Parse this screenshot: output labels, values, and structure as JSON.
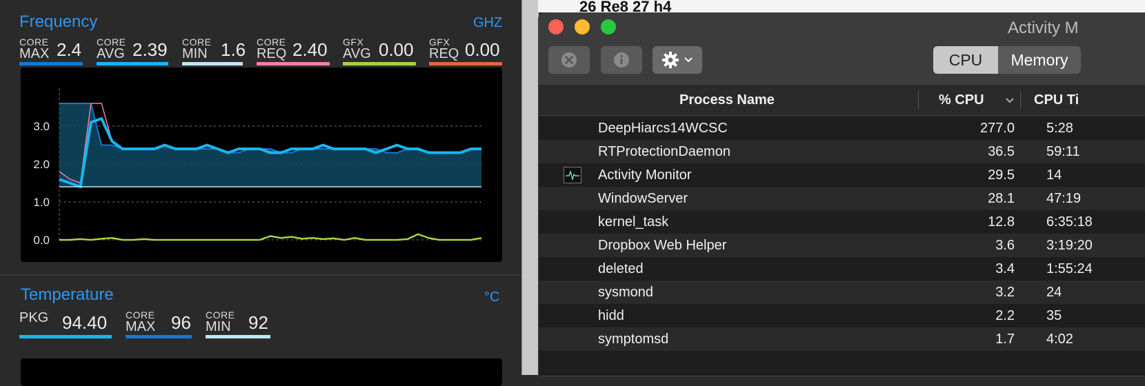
{
  "gadget": {
    "frequency": {
      "title": "Frequency",
      "unit": "GHZ",
      "metrics": [
        {
          "l1": "CORE",
          "l2": "MAX",
          "value": "2.4",
          "color": "#1577d6"
        },
        {
          "l1": "CORE",
          "l2": "AVG",
          "value": "2.39",
          "color": "#19b5f0"
        },
        {
          "l1": "CORE",
          "l2": "MIN",
          "value": "1.6",
          "color": "#bfe7f7"
        },
        {
          "l1": "CORE",
          "l2": "REQ",
          "value": "2.40",
          "color": "#f07fa8"
        },
        {
          "l1": "GFX",
          "l2": "AVG",
          "value": "0.00",
          "color": "#a6d443"
        },
        {
          "l1": "GFX",
          "l2": "REQ",
          "value": "0.00",
          "color": "#e0653e"
        }
      ],
      "y_ticks": [
        "3.0",
        "2.0",
        "1.0",
        "0.0"
      ]
    },
    "temperature": {
      "title": "Temperature",
      "unit": "°C",
      "metrics": [
        {
          "l1": "",
          "l2": "PKG",
          "value": "94.40",
          "color": "#19b5f0"
        },
        {
          "l1": "CORE",
          "l2": "MAX",
          "value": "96",
          "color": "#1577d6"
        },
        {
          "l1": "CORE",
          "l2": "MIN",
          "value": "92",
          "color": "#bfe7f7"
        }
      ]
    }
  },
  "background_window": {
    "text": "26 Re8 27 h4"
  },
  "activity_monitor": {
    "title": "Activity M",
    "toolbar": {
      "stop_icon": "x-circle-icon",
      "info_icon": "info-icon",
      "gear_icon": "gear-icon"
    },
    "tabs": [
      {
        "label": "CPU",
        "selected": true
      },
      {
        "label": "Memory",
        "selected": false
      }
    ],
    "columns": {
      "name": "Process Name",
      "cpu": "% CPU",
      "time": "CPU Ti"
    },
    "processes": [
      {
        "name": "DeepHiarcs14WCSC",
        "cpu": "277.0",
        "time": "5:28",
        "icon": false
      },
      {
        "name": "RTProtectionDaemon",
        "cpu": "36.5",
        "time": "59:11",
        "icon": false
      },
      {
        "name": "Activity Monitor",
        "cpu": "29.5",
        "time": "14",
        "icon": true
      },
      {
        "name": "WindowServer",
        "cpu": "28.1",
        "time": "47:19",
        "icon": false
      },
      {
        "name": "kernel_task",
        "cpu": "12.8",
        "time": "6:35:18",
        "icon": false
      },
      {
        "name": "Dropbox Web Helper",
        "cpu": "3.6",
        "time": "3:19:20",
        "icon": false
      },
      {
        "name": "deleted",
        "cpu": "3.4",
        "time": "1:55:24",
        "icon": false
      },
      {
        "name": "sysmond",
        "cpu": "3.2",
        "time": "24",
        "icon": false
      },
      {
        "name": "hidd",
        "cpu": "2.2",
        "time": "35",
        "icon": false
      },
      {
        "name": "symptomsd",
        "cpu": "1.7",
        "time": "4:02",
        "icon": false
      }
    ]
  },
  "chart_data": {
    "type": "line",
    "ylim": [
      0,
      4
    ],
    "ylabel": "",
    "series": [
      {
        "color": "#1577d6",
        "values": [
          3.6,
          3.6,
          3.6,
          3.6,
          2.5,
          2.5,
          2.4,
          2.4,
          2.4,
          2.4,
          2.5,
          2.4,
          2.4,
          2.4,
          2.4,
          2.4,
          2.3,
          2.3,
          2.4,
          2.4,
          2.4,
          2.3,
          2.3,
          2.4,
          2.4,
          2.4,
          2.4,
          2.4,
          2.4,
          2.4,
          2.4,
          2.3,
          2.3,
          2.4,
          2.4,
          2.3,
          2.3,
          2.3,
          2.3,
          2.4,
          2.4
        ]
      },
      {
        "color": "#19b5f0",
        "values": [
          1.6,
          1.5,
          1.4,
          3.1,
          3.2,
          2.6,
          2.4,
          2.4,
          2.4,
          2.4,
          2.5,
          2.4,
          2.4,
          2.4,
          2.5,
          2.4,
          2.3,
          2.4,
          2.4,
          2.4,
          2.3,
          2.3,
          2.4,
          2.4,
          2.4,
          2.5,
          2.4,
          2.4,
          2.4,
          2.4,
          2.3,
          2.4,
          2.5,
          2.4,
          2.4,
          2.3,
          2.3,
          2.3,
          2.3,
          2.4,
          2.4
        ]
      },
      {
        "color": "#bfe7f7",
        "values": [
          1.4,
          1.4,
          1.4,
          1.4,
          1.4,
          1.4,
          1.4,
          1.4,
          1.4,
          1.4,
          1.4,
          1.4,
          1.4,
          1.4,
          1.4,
          1.4,
          1.4,
          1.4,
          1.4,
          1.4,
          1.4,
          1.4,
          1.4,
          1.4,
          1.4,
          1.4,
          1.4,
          1.4,
          1.4,
          1.4,
          1.4,
          1.4,
          1.4,
          1.4,
          1.4,
          1.4,
          1.4,
          1.4,
          1.4,
          1.4,
          1.4
        ]
      },
      {
        "color": "#f07fa8",
        "values": [
          1.8,
          1.6,
          1.5,
          3.6,
          3.6,
          2.6,
          2.4,
          2.4,
          2.4,
          2.4,
          2.5,
          2.4,
          2.4,
          2.4,
          2.5,
          2.4,
          2.3,
          2.4,
          2.4,
          2.4,
          2.3,
          2.3,
          2.4,
          2.4,
          2.4,
          2.5,
          2.4,
          2.4,
          2.4,
          2.4,
          2.3,
          2.4,
          2.5,
          2.4,
          2.4,
          2.3,
          2.3,
          2.3,
          2.3,
          2.4,
          2.4
        ]
      },
      {
        "color": "#a6d443",
        "values": [
          0.0,
          0.0,
          0.02,
          0.0,
          0.03,
          0.05,
          0.0,
          0.0,
          0.02,
          0.0,
          0.0,
          0.0,
          0.0,
          0.0,
          0.0,
          0.0,
          0.0,
          0.0,
          0.0,
          0.0,
          0.1,
          0.05,
          0.08,
          0.03,
          0.05,
          0.02,
          0.04,
          0.0,
          0.05,
          0.0,
          0.0,
          0.0,
          0.0,
          0.02,
          0.15,
          0.05,
          0.0,
          0.0,
          0.0,
          0.0,
          0.05
        ]
      }
    ]
  }
}
